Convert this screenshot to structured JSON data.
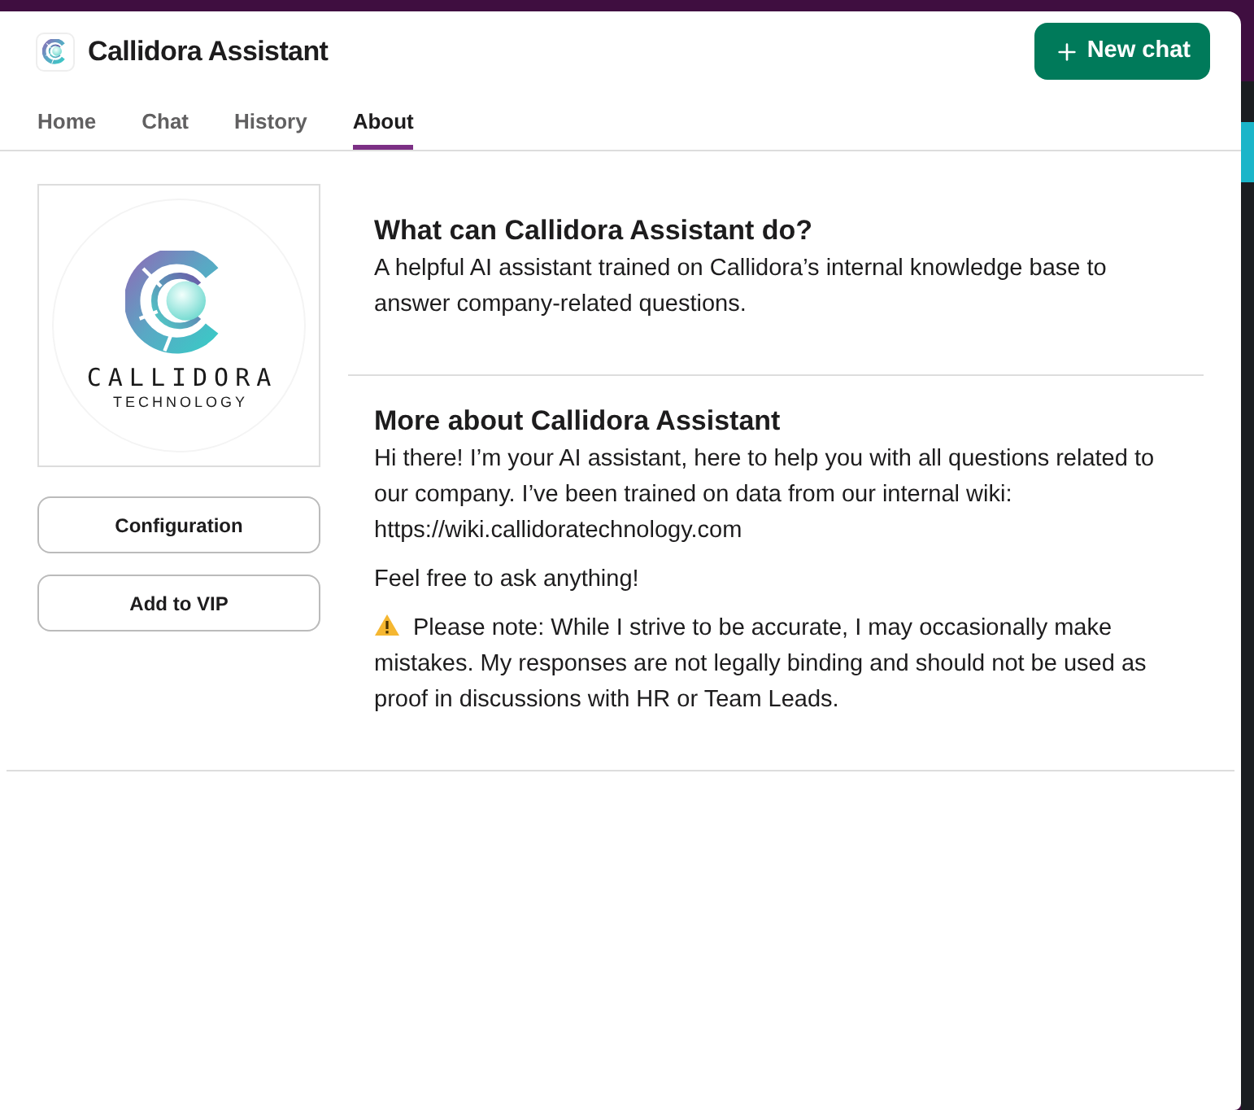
{
  "app": {
    "title": "Callidora Assistant",
    "new_chat_button": "New chat"
  },
  "tabs": [
    {
      "label": "Home",
      "selected": false
    },
    {
      "label": "Chat",
      "selected": false
    },
    {
      "label": "History",
      "selected": false
    },
    {
      "label": "About",
      "selected": true
    }
  ],
  "sidebar": {
    "logo": {
      "wordmark": "CALLIDORA",
      "tagline": "TECHNOLOGY"
    },
    "buttons": [
      {
        "label": "Configuration"
      },
      {
        "label": "Add to VIP"
      }
    ]
  },
  "sections": [
    {
      "title": "What can Callidora Assistant do?",
      "paragraphs": [
        {
          "kind": "text",
          "text": "A helpful AI assistant trained on Callidora’s internal knowledge base to answer company-related questions."
        }
      ]
    },
    {
      "title": "More about Callidora Assistant",
      "paragraphs": [
        {
          "kind": "text",
          "text": "Hi there! I’m your AI assistant, here to help you with all questions related to our company. I’ve been trained on data from our internal wiki: https://wiki.callidoratechnology.com"
        },
        {
          "kind": "text",
          "text": "Feel free to ask anything!"
        },
        {
          "kind": "warning",
          "text": "Please note: While I strive to be accurate, I may occasionally make mistakes. My responses are not legally binding and should not be used as proof in discussions with HR or Team Leads."
        }
      ]
    }
  ]
}
